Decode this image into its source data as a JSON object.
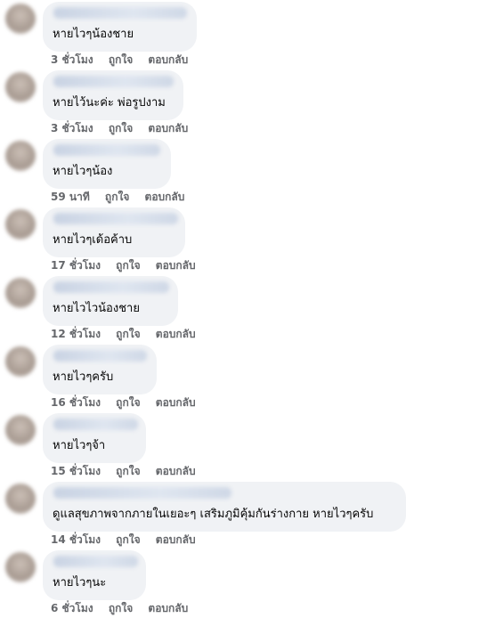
{
  "comments": [
    {
      "text": "หายไวๆน้องชาย",
      "time": "3 ชั่วโมง",
      "like": "ถูกใจ",
      "reply": "ตอบกลับ"
    },
    {
      "text": "หายไว้นะค่ะ พ่อรูปงาม",
      "time": "3 ชั่วโมง",
      "like": "ถูกใจ",
      "reply": "ตอบกลับ"
    },
    {
      "text": "หายไวๆน้อง",
      "time": "59 นาที",
      "like": "ถูกใจ",
      "reply": "ตอบกลับ"
    },
    {
      "text": "หายไวๆเด้อค้าบ",
      "time": "17 ชั่วโมง",
      "like": "ถูกใจ",
      "reply": "ตอบกลับ"
    },
    {
      "text": "หายไวไวน้องชาย",
      "time": "12 ชั่วโมง",
      "like": "ถูกใจ",
      "reply": "ตอบกลับ"
    },
    {
      "text": "หายไวๆครับ",
      "time": "16 ชั่วโมง",
      "like": "ถูกใจ",
      "reply": "ตอบกลับ"
    },
    {
      "text": "หายไวๆจ้า",
      "time": "15 ชั่วโมง",
      "like": "ถูกใจ",
      "reply": "ตอบกลับ"
    },
    {
      "text": "ดูแลสุขภาพจากภายในเยอะๆ เสริมภูมิคุ้มกันร่างกาย หายไวๆครับ",
      "time": "14 ชั่วโมง",
      "like": "ถูกใจ",
      "reply": "ตอบกลับ"
    },
    {
      "text": "หายไวๆนะ",
      "time": "6 ชั่วโมง",
      "like": "ถูกใจ",
      "reply": "ตอบกลับ"
    }
  ]
}
